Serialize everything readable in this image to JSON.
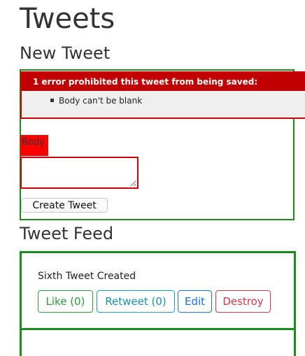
{
  "page": {
    "title": "Tweets"
  },
  "new_tweet": {
    "heading": "New Tweet",
    "error": {
      "header": "1 error prohibited this tweet from being saved:",
      "messages": [
        "Body can't be blank"
      ]
    },
    "body_label": "Body",
    "body_value": "",
    "submit_label": "Create Tweet"
  },
  "feed": {
    "heading": "Tweet Feed",
    "tweets": [
      {
        "body": "Sixth Tweet Created",
        "like_label": "Like (0)",
        "retweet_label": "Retweet (0)",
        "edit_label": "Edit",
        "destroy_label": "Destroy"
      }
    ]
  },
  "colors": {
    "form_border": "#1e8a1e",
    "error_red": "#c00000",
    "like": "#2a9d3a",
    "retweet": "#1a90b0",
    "edit": "#1a6fd8",
    "destroy": "#d33a4a"
  }
}
